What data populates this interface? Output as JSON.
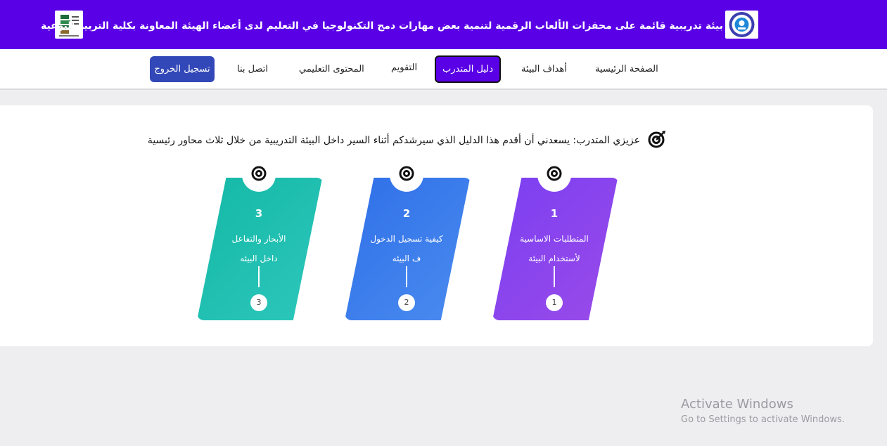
{
  "header": {
    "title": "بيئة تدريبية قائمة على محفزات الألعاب الرقمية لتنمية بعض مهارات دمج التكنولوجيا في التعليم لدى أعضاء الهيئة المعاونة بكلية التربية النوعية",
    "logo_left": "faculty-logo",
    "logo_right": "university-logo",
    "background_color": "#5a00e6"
  },
  "nav": {
    "home": "الصفحة الرئيسية",
    "goals": "أهداف البيئة",
    "guide": "دليل المتدرب",
    "evaluation": "التقويم",
    "content": "المحتوى التعليمي",
    "contact": "اتصل بنا",
    "logout": "تسجيل الخروج"
  },
  "main": {
    "intro": "عزيزي المتدرب: يسعدني أن أقدم هذا الدليل الذي سيرشدكم أثناء السير داخل البيئة التدريبية من خلال ثلاث محاور رئيسية",
    "intro_icon": "target-icon",
    "steps": [
      {
        "number": "1",
        "title_line1": "المتطلبات الاساسية",
        "title_line2": "لأستخدام البيئة",
        "badge": "1",
        "color_start": "#7b3ff2",
        "color_end": "#9a4be8"
      },
      {
        "number": "2",
        "title_line1": "كيفية تسجيل الدخول",
        "title_line2": "ف البيئه",
        "badge": "2",
        "color_start": "#2f6fe8",
        "color_end": "#4a8cf0"
      },
      {
        "number": "3",
        "title_line1": "الأبحار والتفاعل",
        "title_line2": "داخل البيئه",
        "badge": "3",
        "color_start": "#14b8a6",
        "color_end": "#2dc7bc"
      }
    ]
  },
  "watermark": {
    "title": "Activate Windows",
    "subtitle": "Go to Settings to activate Windows."
  }
}
